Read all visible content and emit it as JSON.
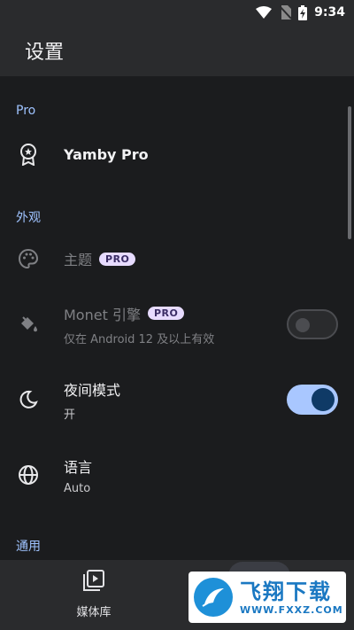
{
  "status_bar": {
    "time": "9:34",
    "icons": [
      "wifi-icon",
      "no-sim-icon",
      "battery-charging-icon"
    ]
  },
  "app_bar": {
    "title": "设置"
  },
  "sections": [
    {
      "header": "Pro",
      "items": [
        {
          "icon": "award-icon",
          "label": "Yamby Pro"
        }
      ]
    },
    {
      "header": "外观",
      "items": [
        {
          "icon": "palette-icon",
          "label": "主题",
          "badge": "PRO",
          "disabled": true
        },
        {
          "icon": "paint-bucket-icon",
          "label": "Monet 引擎",
          "badge": "PRO",
          "subtitle": "仅在 Android 12 及以上有效",
          "disabled": true,
          "toggle": false
        },
        {
          "icon": "moon-icon",
          "label": "夜间模式",
          "subtitle": "开",
          "toggle": true
        },
        {
          "icon": "globe-icon",
          "label": "语言",
          "subtitle": "Auto"
        }
      ]
    },
    {
      "header": "通用",
      "items": []
    }
  ],
  "bottom_nav": {
    "items": [
      {
        "icon": "media-library-icon",
        "label": "媒体库"
      }
    ]
  },
  "watermark": {
    "text": "飞翔下载",
    "url": "WWW.FXXZ.COM"
  },
  "colors": {
    "accent": "#a9c7ff",
    "background": "#1b1c1e",
    "surface": "#2a2b2d",
    "section_header": "#9fc3ff"
  }
}
